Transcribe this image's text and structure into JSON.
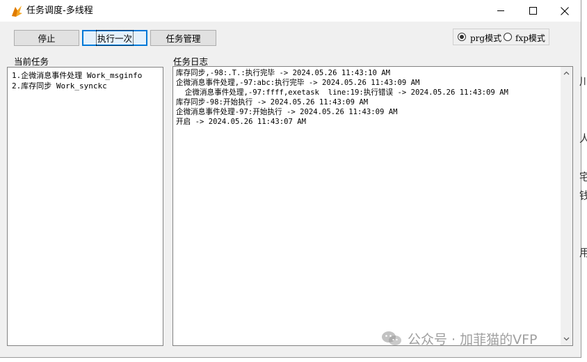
{
  "window": {
    "title": "任务调度-多线程",
    "controls": {
      "minimize": "minimize",
      "maximize": "maximize",
      "close": "close"
    }
  },
  "toolbar": {
    "stop_label": "停止",
    "run_once_label": "执行一次",
    "task_manage_label": "任务管理"
  },
  "mode": {
    "prg_label": "prg模式",
    "fxp_label": "fxp模式",
    "selected": "prg模式"
  },
  "current_tasks": {
    "label": "当前任务",
    "items": [
      "1.企微消息事件处理 Work_msginfo",
      "2.库存同步 Work_synckc"
    ]
  },
  "task_log": {
    "label": "任务日志",
    "lines": [
      "库存同步,-98:.T.:执行完毕 -> 2024.05.26 11:43:10 AM",
      "企微消息事件处理,-97:abc:执行完毕 -> 2024.05.26 11:43:09 AM",
      "  企微消息事件处理,-97:ffff,exetask  line:19:执行错误 -> 2024.05.26 11:43:09 AM",
      "库存同步-98:开始执行 -> 2024.05.26 11:43:09 AM",
      "企微消息事件处理-97:开始执行 -> 2024.05.26 11:43:09 AM",
      "开启 -> 2024.05.26 11:43:07 AM"
    ]
  },
  "watermark": {
    "text": "公众号 · 加菲猫的VFP"
  },
  "colors": {
    "focus_border": "#0078d7",
    "button_bg": "#e1e1e1",
    "window_bg": "#f0f0f0"
  },
  "background_glyphs": [
    "川",
    "人",
    "宅",
    "钱",
    "用"
  ]
}
